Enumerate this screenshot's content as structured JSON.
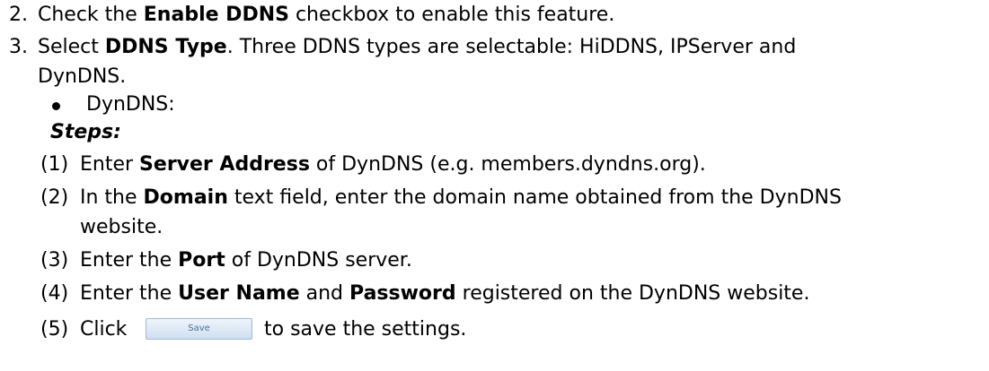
{
  "steps": {
    "step2": {
      "number": "2.",
      "text_before": "Check the ",
      "bold": "Enable DDNS",
      "text_after": " checkbox to enable this feature."
    },
    "step3": {
      "number": "3.",
      "text_before": "Select ",
      "bold": "DDNS Type",
      "text_after": ". Three DDNS types are selectable: HiDDNS, IPServer and",
      "continuation": "DynDNS."
    }
  },
  "bullet_item": "DynDNS:",
  "steps_heading": "Steps:",
  "substeps": {
    "s1": {
      "number": "(1)",
      "text_before": "Enter ",
      "bold": "Server Address",
      "text_after": " of DynDNS (e.g. members.dyndns.org)."
    },
    "s2": {
      "number": "(2)",
      "text_before": "In the ",
      "bold": "Domain",
      "text_after": " text field, enter the domain name obtained from the DynDNS",
      "continuation": "website."
    },
    "s3": {
      "number": "(3)",
      "text_before": "Enter the ",
      "bold": "Port",
      "text_after": " of DynDNS server."
    },
    "s4": {
      "number": "(4)",
      "text_before": "Enter the ",
      "bold1": "User Name",
      "middle": " and ",
      "bold2": "Password",
      "text_after": " registered on the DynDNS website."
    },
    "s5": {
      "number": "(5)",
      "text_before": "Click",
      "button_label": "Save",
      "text_after": "to save the settings."
    }
  }
}
